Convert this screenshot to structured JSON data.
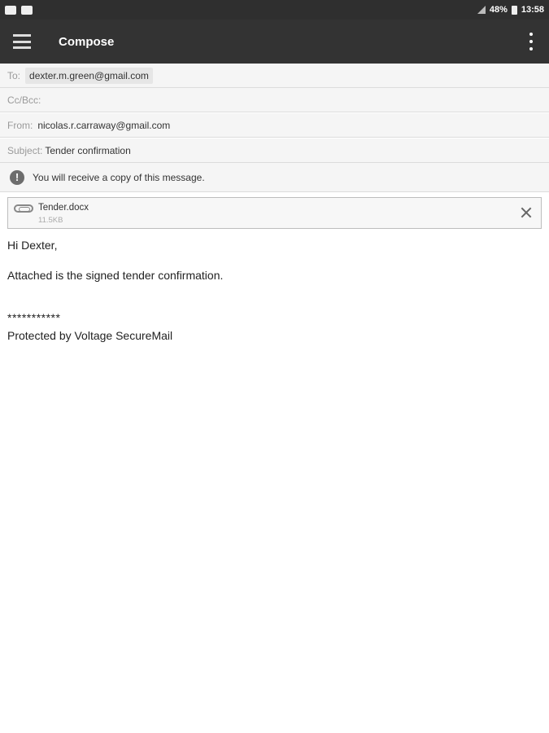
{
  "status_bar": {
    "battery": "48%",
    "time": "13:58"
  },
  "app_bar": {
    "title": "Compose"
  },
  "fields": {
    "to_label": "To:",
    "to_value": "dexter.m.green@gmail.com",
    "cc_label": "Cc/Bcc:",
    "from_label": "From:",
    "from_value": "nicolas.r.carraway@gmail.com",
    "subject_label": "Subject:",
    "subject_value": "Tender confirmation"
  },
  "notice": {
    "icon": "!",
    "text": "You will receive a copy of this message."
  },
  "attachment": {
    "name": "Tender.docx",
    "size": "11.5KB"
  },
  "body": {
    "greeting": "Hi Dexter,",
    "line1": "Attached is the signed tender confirmation.",
    "separator": "***********",
    "signature": "Protected by Voltage SecureMail"
  }
}
